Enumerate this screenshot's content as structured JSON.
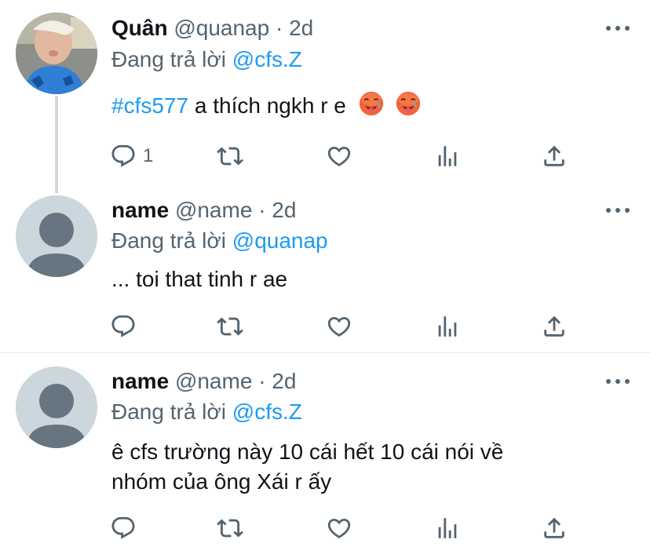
{
  "tweets": [
    {
      "name": "Quân",
      "handle": "@quanap",
      "separator": "·",
      "time": "2d",
      "replying_label": "Đang trả lời",
      "replying_to": "@cfs.Z",
      "hashtag": "#cfs577",
      "text": "a thích ngkh r e",
      "emojis": [
        "hot-face-emoji",
        "hot-face-emoji"
      ],
      "reply_count": "1",
      "avatar": "photo"
    },
    {
      "name": "name",
      "handle": "@name",
      "separator": "·",
      "time": "2d",
      "replying_label": "Đang trả lời",
      "replying_to": "@quanap",
      "text": "... toi that tinh r ae",
      "avatar": "default-person"
    },
    {
      "name": "name",
      "handle": "@name",
      "separator": "·",
      "time": "2d",
      "replying_label": "Đang trả lời",
      "replying_to": "@cfs.Z",
      "text_line1": "ê cfs trường này 10 cái hết 10 cái nói về",
      "text_line2": "nhóm của ông Xái r ấy",
      "avatar": "default-person"
    }
  ],
  "icons": [
    "reply-icon",
    "retweet-icon",
    "like-icon",
    "analytics-icon",
    "share-icon",
    "more-icon"
  ],
  "colors": {
    "link": "#1d9bf0",
    "secondary": "#536471",
    "text": "#0f1419",
    "icon": "#536471"
  }
}
